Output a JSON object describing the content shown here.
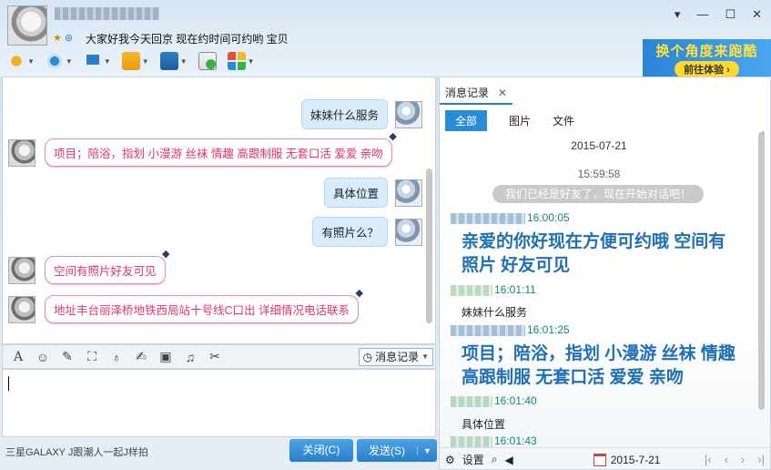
{
  "header": {
    "status_icons": [
      "★",
      "⊛"
    ],
    "signature": "大家好我今天回京   现在约时间可约哟 宝贝",
    "window_controls": [
      "▾",
      "—",
      "☐",
      "✕"
    ]
  },
  "ad": {
    "title": "换个角度来跑酷",
    "button": "前往体验 ›"
  },
  "chat": {
    "messages": [
      {
        "side": "right",
        "text": "妹妹什么服务"
      },
      {
        "side": "left",
        "text": "项目；陪浴，指划 小漫游 丝袜 情趣 高跟制服 无套口活 爱爱 亲吻"
      },
      {
        "side": "right",
        "text": "具体位置"
      },
      {
        "side": "right",
        "text": "有照片么？"
      },
      {
        "side": "left",
        "text": "空间有照片好友可见"
      },
      {
        "side": "left",
        "text": "地址丰台丽泽桥地铁西局站十号线C口出   详细情况电话联系"
      }
    ]
  },
  "input_toolbar": {
    "history_label": "消息记录"
  },
  "bottom": {
    "ad_text": "三星GALAXY J跟潮人一起J样拍",
    "close": "关闭(C)",
    "send": "发送(S)"
  },
  "history": {
    "tab_title": "消息记录",
    "filters": [
      "全部",
      "图片",
      "文件"
    ],
    "date": "2015-07-21",
    "time": "15:59:58",
    "system_msg": "我们已经是好友了，现在开始对话吧！",
    "entries": [
      {
        "time": "16:00:05",
        "text": "亲爱的你好现在方便可约哦 空间有照片  好友可见",
        "style": "big"
      },
      {
        "time": "16:01:11",
        "text": "妹妹什么服务",
        "style": "plain"
      },
      {
        "time": "16:01:25",
        "text": "项目；陪浴，指划 小漫游 丝袜 情趣 高跟制服 无套口活 爱爱 亲吻",
        "style": "big"
      },
      {
        "time": "16:01:40",
        "text": "具体位置",
        "style": "plain"
      },
      {
        "time": "16:01:43",
        "text": "",
        "style": "plain"
      }
    ],
    "settings": "设置",
    "footer_date": "2015-7-21"
  },
  "colors": {
    "accent": "#2a8bd6",
    "pink_text": "#e0336b",
    "big_text": "#1f6fb5"
  }
}
